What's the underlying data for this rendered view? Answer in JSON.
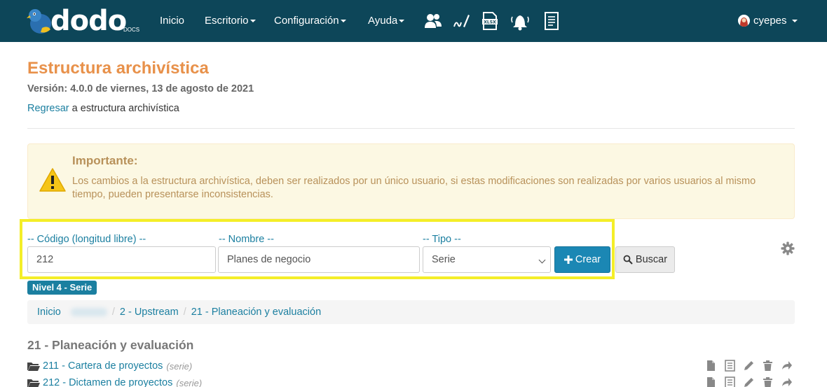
{
  "navbar": {
    "logo_text": "dodo",
    "logo_sub": "DOCS",
    "menu": [
      {
        "label": "Inicio"
      },
      {
        "label": "Escritorio"
      },
      {
        "label": "Configuración"
      },
      {
        "label": "Ayuda"
      }
    ],
    "icons": [
      "users-icon",
      "signature-icon",
      "xlsx-icon",
      "bell-icon",
      "document-list-icon"
    ],
    "user": "cyepes"
  },
  "header": {
    "title": "Estructura archivística",
    "version": "Versión: 4.0.0 de viernes, 13 de agosto de 2021",
    "back_link": "Regresar",
    "back_text": " a estructura archivística"
  },
  "alert": {
    "title": "Importante:",
    "body": "Los cambios a la estructura archivística, deben ser realizados por un único usuario, si estas modificaciones son realizadas por varios usuarios al mismo tiempo, pueden presentarse inconsistencias."
  },
  "form": {
    "codigo_label": "-- Código (longitud libre) --",
    "codigo_value": "212",
    "nombre_label": "-- Nombre --",
    "nombre_value": "Planes de negocio",
    "tipo_label": "-- Tipo --",
    "tipo_value": "Serie",
    "crear_label": "Crear",
    "buscar_label": "Buscar"
  },
  "level_badge": "Nivel 4 - Serie",
  "breadcrumb": {
    "items": [
      "Inicio",
      "2 - Upstream",
      "21 - Planeación y evaluación"
    ]
  },
  "section_title": "21 - Planeación y evaluación",
  "rows": [
    {
      "label": "211 - Cartera de proyectos",
      "tag": "(serie)"
    },
    {
      "label": "212 - Dictamen de proyectos",
      "tag": "(serie)"
    }
  ],
  "colors": {
    "navbar": "#0d4659",
    "accent_orange": "#e8914a",
    "link": "#1b7fa0",
    "highlight": "#f4ee28"
  }
}
